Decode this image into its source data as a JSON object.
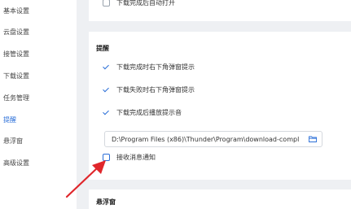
{
  "sidebar": {
    "items": [
      {
        "label": "基本设置",
        "active": false
      },
      {
        "label": "云盘设置",
        "active": false
      },
      {
        "label": "接管设置",
        "active": false
      },
      {
        "label": "下载设置",
        "active": false
      },
      {
        "label": "任务管理",
        "active": false
      },
      {
        "label": "提醒",
        "active": true
      },
      {
        "label": "悬浮窗",
        "active": false
      },
      {
        "label": "高级设置",
        "active": false
      }
    ]
  },
  "top_card": {
    "auto_open_label": "下载完成后自动打开",
    "auto_open_checked": false
  },
  "reminder": {
    "title": "提醒",
    "options": [
      {
        "label": "下载完成时右下角弹窗提示",
        "checked": true
      },
      {
        "label": "下载失败时右下角弹窗提示",
        "checked": true
      },
      {
        "label": "下载完成后播放提示音",
        "checked": true
      }
    ],
    "sound_path": "D:\\Program Files (x86)\\Thunder\\Program\\download-compl",
    "receive_notice_label": "接收消息通知",
    "receive_notice_checked": false
  },
  "float_window": {
    "title": "悬浮窗"
  },
  "colors": {
    "accent": "#2b6fd8",
    "arrow": "#e0262b",
    "background": "#eef0f3"
  }
}
